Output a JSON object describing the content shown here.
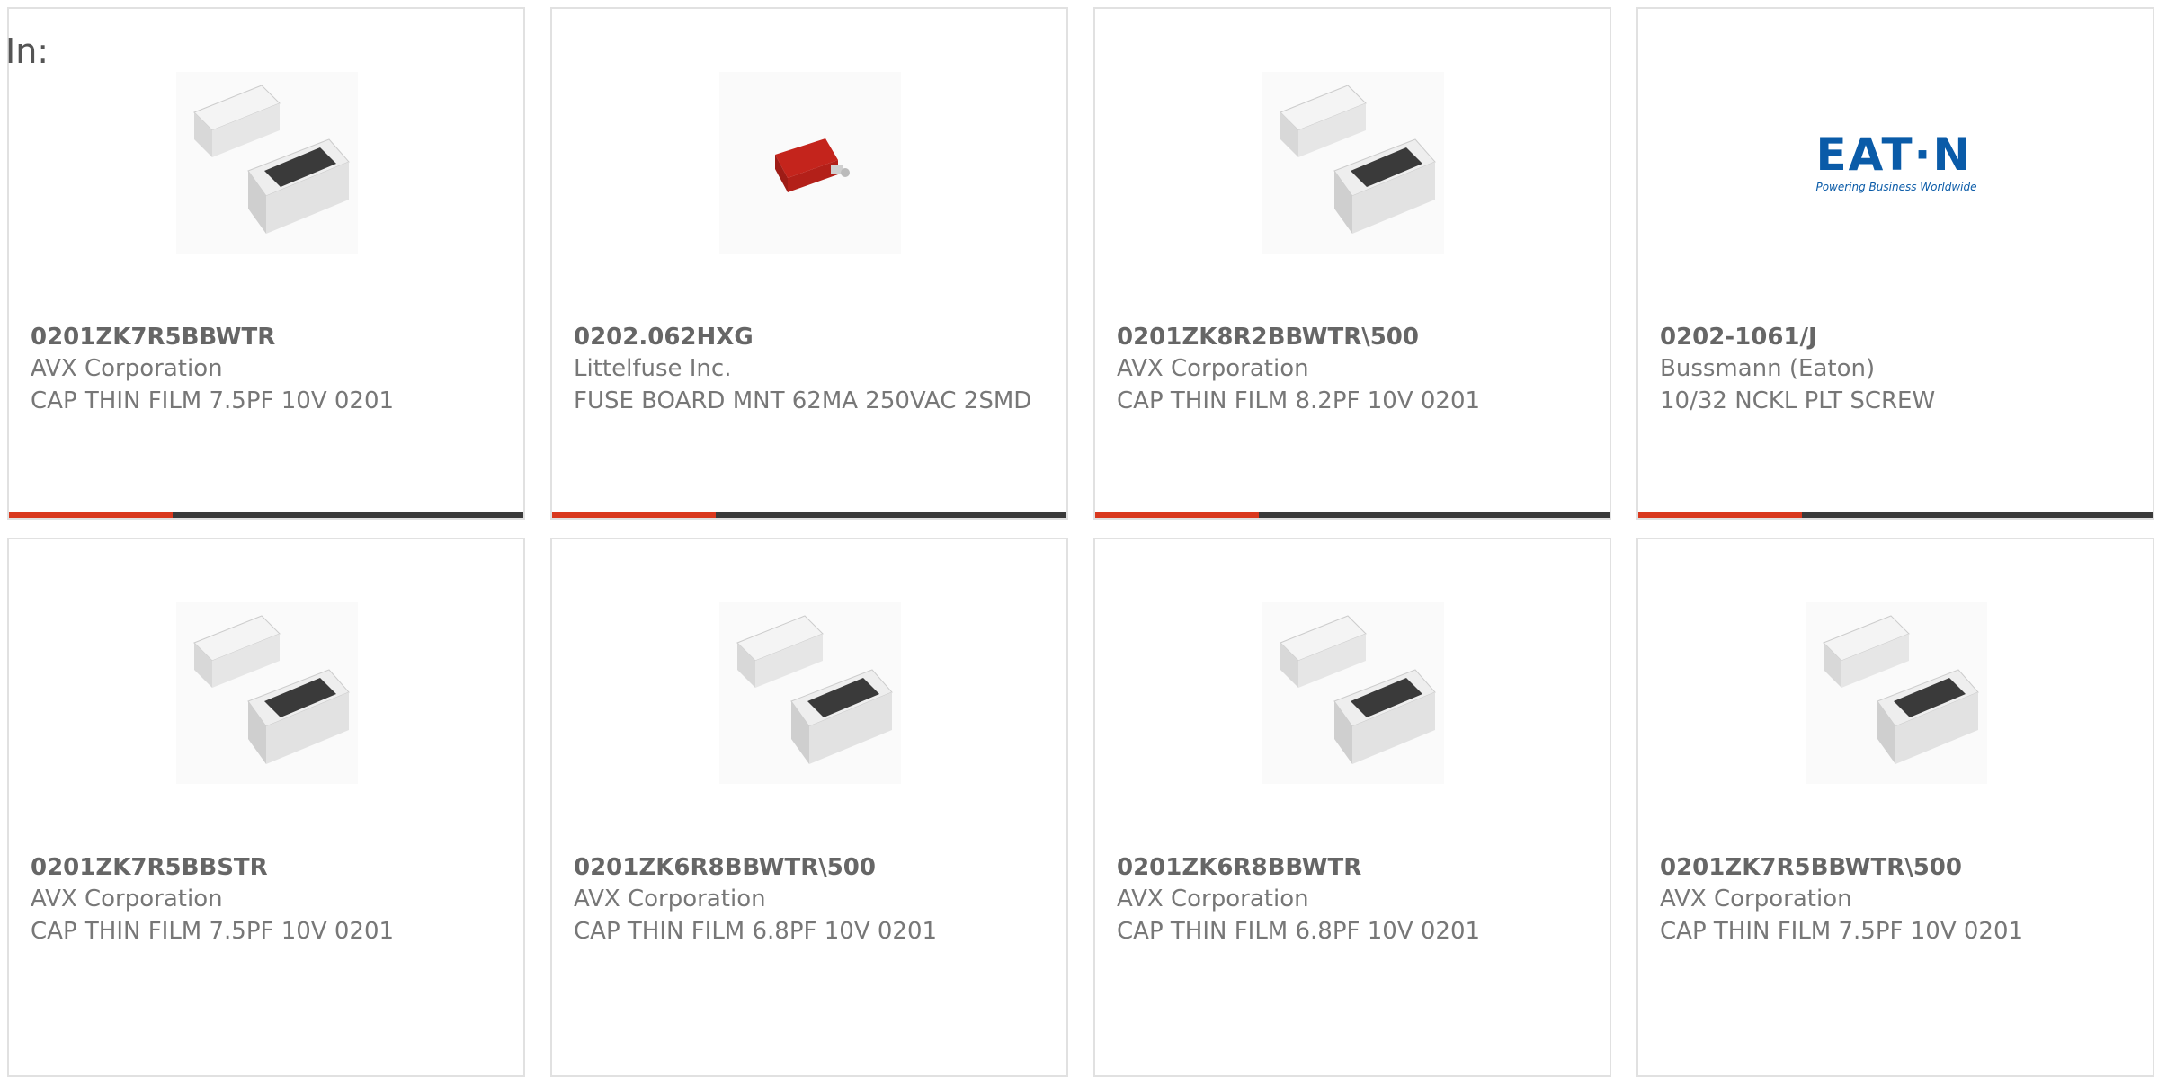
{
  "filter_label": "In:",
  "colors": {
    "accent": "#d9381e",
    "bar": "#3a3a3a",
    "card_border": "#e1e1e1",
    "text": "#666666"
  },
  "products": [
    {
      "part_number": "0201ZK7R5BBWTR",
      "manufacturer": "AVX Corporation",
      "description": "CAP THIN FILM 7.5PF 10V 0201",
      "image": "capacitor-chip-image"
    },
    {
      "part_number": "0202.062HXG",
      "manufacturer": "Littelfuse Inc.",
      "description": "FUSE BOARD MNT 62MA 250VAC 2SMD",
      "image": "fuse-image"
    },
    {
      "part_number": "0201ZK8R2BBWTR\\500",
      "manufacturer": "AVX Corporation",
      "description": "CAP THIN FILM 8.2PF 10V 0201",
      "image": "capacitor-chip-image"
    },
    {
      "part_number": "0202-1061/J",
      "manufacturer": "Bussmann (Eaton)",
      "description": "10/32 NCKL PLT SCREW",
      "image": "eaton-logo",
      "logo_text": "EAT·N",
      "logo_tagline": "Powering Business Worldwide"
    },
    {
      "part_number": "0201ZK7R5BBSTR",
      "manufacturer": "AVX Corporation",
      "description": "CAP THIN FILM 7.5PF 10V 0201",
      "image": "capacitor-chip-image"
    },
    {
      "part_number": "0201ZK6R8BBWTR\\500",
      "manufacturer": "AVX Corporation",
      "description": "CAP THIN FILM 6.8PF 10V 0201",
      "image": "capacitor-chip-image"
    },
    {
      "part_number": "0201ZK6R8BBWTR",
      "manufacturer": "AVX Corporation",
      "description": "CAP THIN FILM 6.8PF 10V 0201",
      "image": "capacitor-chip-image"
    },
    {
      "part_number": "0201ZK7R5BBWTR\\500",
      "manufacturer": "AVX Corporation",
      "description": "CAP THIN FILM 7.5PF 10V 0201",
      "image": "capacitor-chip-image"
    }
  ]
}
